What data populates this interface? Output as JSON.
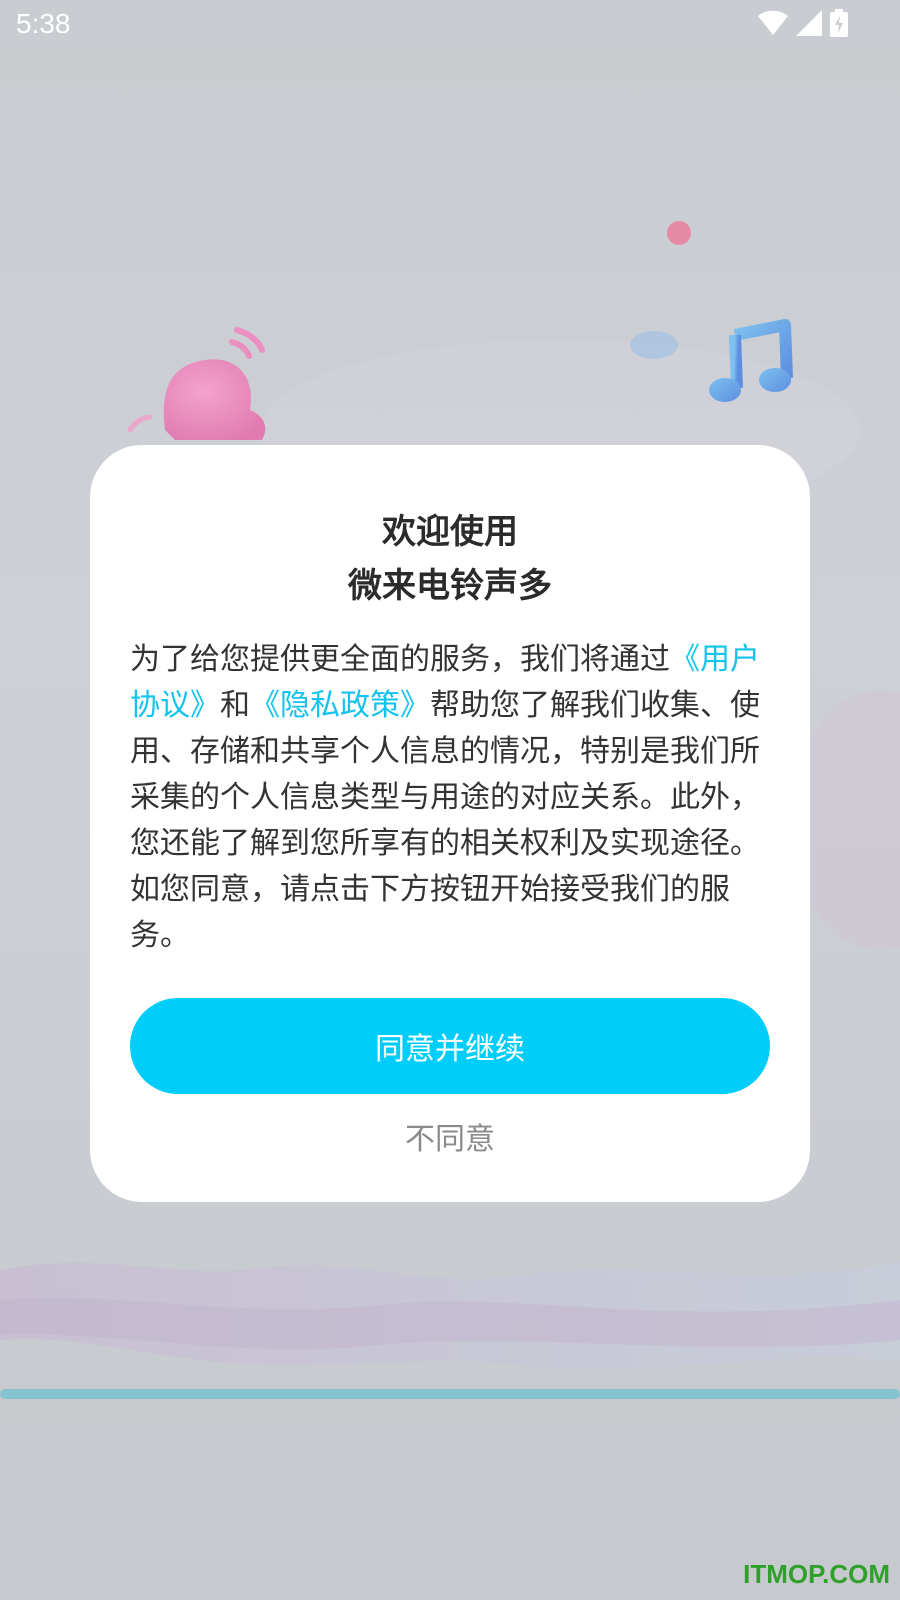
{
  "status_bar": {
    "time": "5:38",
    "icons": [
      "wifi-icon",
      "cellular-signal-icon",
      "battery-charging-icon"
    ]
  },
  "dialog": {
    "title_line1": "欢迎使用",
    "title_line2": "微来电铃声多",
    "body": {
      "part1": "为了给您提供更全面的服务，我们将通过",
      "user_agreement_link": "《用户协议》",
      "part2": "和",
      "privacy_policy_link": "《隐私政策》",
      "part3": "帮助您了解我们收集、使用、存储和共享个人信息的情况，特别是我们所采集的个人信息类型与用途的对应关系。此外，您还能了解到您所享有的相关权利及实现途径。如您同意，请点击下方按钮开始接受我们的服务。"
    },
    "agree_button": "同意并继续",
    "disagree_button": "不同意"
  },
  "watermark": "ITMOP.COM",
  "colors": {
    "accent": "#00cdfa",
    "link": "#11c3ee",
    "watermark": "#2fa12b"
  }
}
